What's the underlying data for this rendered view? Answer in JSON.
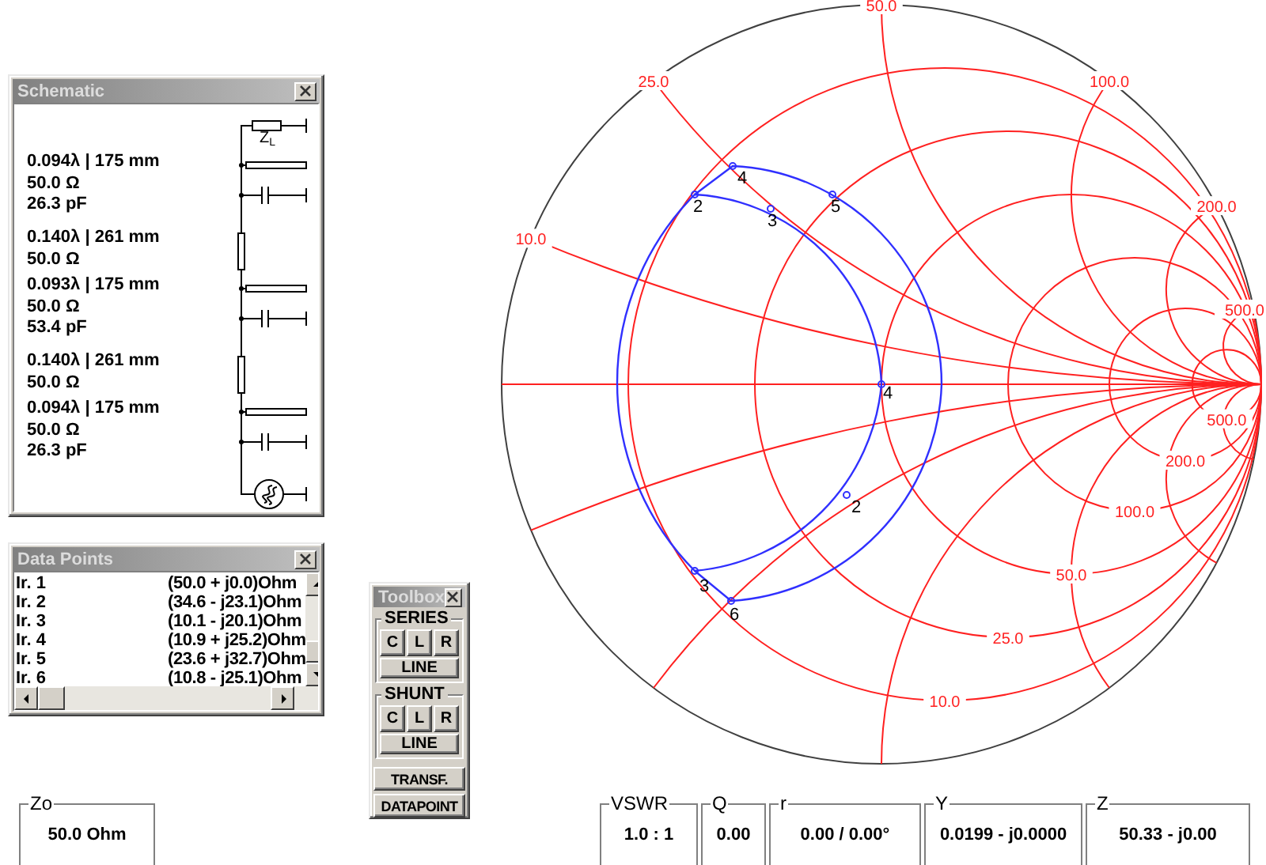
{
  "schematic": {
    "title": "Schematic",
    "load_label": "Z$_{L}$",
    "elements": [
      {
        "kind": "shunt",
        "lines": [
          "0.094λ | 175 mm",
          "50.0  Ω",
          "26.3 pF"
        ]
      },
      {
        "kind": "series",
        "lines": [
          "0.140λ | 261 mm",
          "50.0  Ω"
        ]
      },
      {
        "kind": "shunt",
        "lines": [
          "0.093λ | 175 mm",
          "50.0  Ω",
          "53.4 pF"
        ]
      },
      {
        "kind": "series",
        "lines": [
          "0.140λ | 261 mm",
          "50.0  Ω"
        ]
      },
      {
        "kind": "shunt",
        "lines": [
          "0.094λ | 175 mm",
          "50.0  Ω",
          "26.3 pF"
        ]
      }
    ]
  },
  "data_points": {
    "title": "Data Points",
    "rows": [
      {
        "name": "Ir. 1",
        "value": "(50.0 + j0.0)Ohm"
      },
      {
        "name": "Ir. 2",
        "value": "(34.6 - j23.1)Ohm"
      },
      {
        "name": "Ir. 3",
        "value": "(10.1 - j20.1)Ohm"
      },
      {
        "name": "Ir. 4",
        "value": "(10.9 + j25.2)Ohm"
      },
      {
        "name": "Ir. 5",
        "value": "(23.6 + j32.7)Ohm"
      },
      {
        "name": "Ir. 6",
        "value": "(10.8 - j25.1)Ohm"
      }
    ]
  },
  "toolbox": {
    "title": "Toolbox",
    "groups": [
      {
        "label": "SERIES",
        "buttons": [
          "C",
          "L",
          "R"
        ],
        "wide_button": "LINE"
      },
      {
        "label": "SHUNT",
        "buttons": [
          "C",
          "L",
          "R"
        ],
        "wide_button": "LINE"
      }
    ],
    "actions": [
      "TRANSF.",
      "DATAPOINT"
    ]
  },
  "smith_chart": {
    "reactance_labels": [
      "50.0",
      "25.0",
      "100.0",
      "10.0",
      "200.0",
      "500.0"
    ],
    "resistance_labels": [
      "500.0",
      "200.0",
      "100.0",
      "50.0",
      "25.0",
      "10.0"
    ],
    "points": [
      {
        "label": "4"
      },
      {
        "label": "2"
      },
      {
        "label": "3"
      },
      {
        "label": "5"
      },
      {
        "label": "4"
      },
      {
        "label": "2"
      },
      {
        "label": "3"
      },
      {
        "label": "6"
      }
    ]
  },
  "readouts": [
    {
      "label": "Zo",
      "value": "50.0 Ohm"
    },
    {
      "label": "VSWR",
      "value": "1.0 : 1"
    },
    {
      "label": "Q",
      "value": "0.00"
    },
    {
      "label": "r",
      "value": "0.00 / 0.00°"
    },
    {
      "label": "Y",
      "value": "0.0199 - j0.0000"
    },
    {
      "label": "Z",
      "value": "50.33 - j0.00"
    }
  ]
}
